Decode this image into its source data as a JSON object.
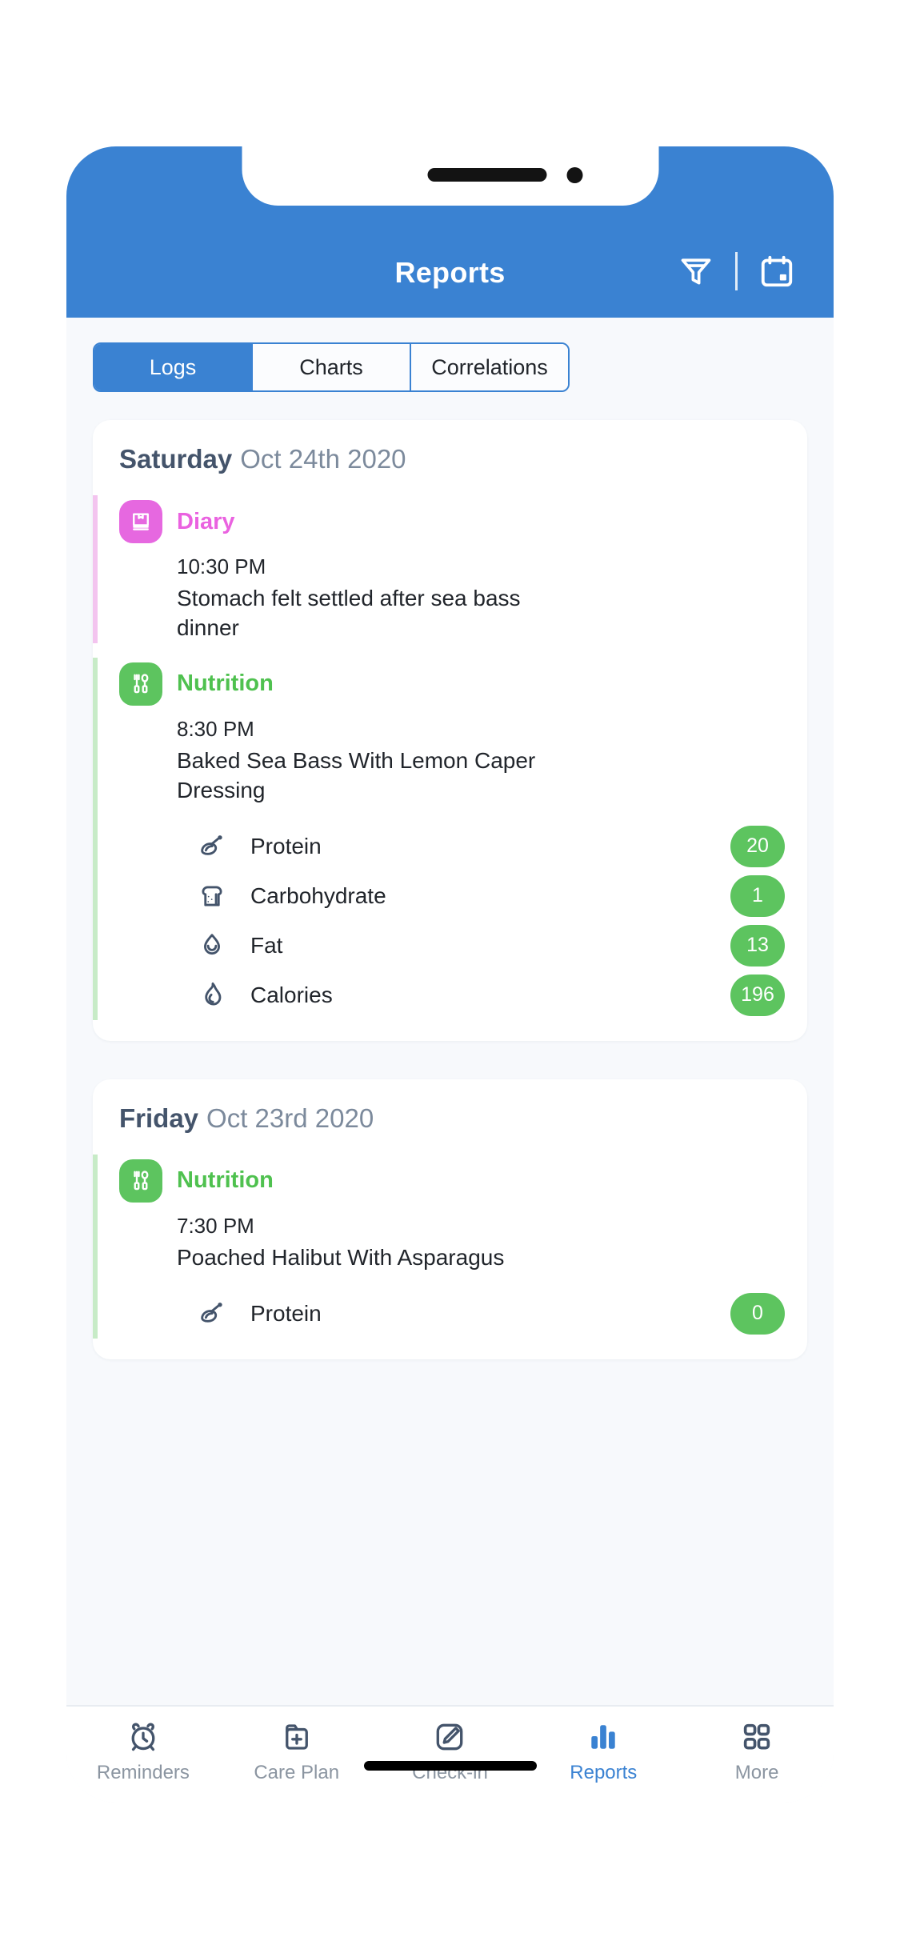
{
  "header": {
    "title": "Reports",
    "brand_color": "#3a82d2",
    "filter_icon": "filter-icon",
    "calendar_icon": "calendar-icon"
  },
  "tabs": [
    {
      "label": "Logs",
      "active": true
    },
    {
      "label": "Charts",
      "active": false
    },
    {
      "label": "Correlations",
      "active": false
    }
  ],
  "cards": [
    {
      "day": "Saturday",
      "date": "Oct 24th 2020",
      "entries": [
        {
          "category": "Diary",
          "category_color": "#ea62e0",
          "rail_color": "#f3c4ef",
          "badge_color": "#e668e0",
          "icon": "journal-icon",
          "time": "10:30 PM",
          "text": "Stomach felt settled after sea bass dinner",
          "nutrients": []
        },
        {
          "category": "Nutrition",
          "category_color": "#4fc14f",
          "rail_color": "#c7ebc7",
          "badge_color": "#5dc45f",
          "icon": "cutlery-icon",
          "time": "8:30 PM",
          "text": "Baked Sea Bass With Lemon Caper Dressing",
          "nutrients": [
            {
              "label": "Protein",
              "icon": "meat-icon",
              "value": "20",
              "color": "#5dc45f"
            },
            {
              "label": "Carbohydrate",
              "icon": "bread-icon",
              "value": "1",
              "color": "#5dc45f"
            },
            {
              "label": "Fat",
              "icon": "drop-icon",
              "value": "13",
              "color": "#5dc45f"
            },
            {
              "label": "Calories",
              "icon": "flame-icon",
              "value": "196",
              "color": "#5dc45f"
            }
          ]
        }
      ]
    },
    {
      "day": "Friday",
      "date": "Oct 23rd 2020",
      "entries": [
        {
          "category": "Nutrition",
          "category_color": "#4fc14f",
          "rail_color": "#c7ebc7",
          "badge_color": "#5dc45f",
          "icon": "cutlery-icon",
          "time": "7:30 PM",
          "text": "Poached Halibut With Asparagus",
          "nutrients": [
            {
              "label": "Protein",
              "icon": "meat-icon",
              "value": "0",
              "color": "#5dc45f"
            }
          ]
        }
      ]
    }
  ],
  "bottom_nav": [
    {
      "label": "Reminders",
      "icon": "alarm-clock-icon",
      "active": false
    },
    {
      "label": "Care Plan",
      "icon": "folder-plus-icon",
      "active": false
    },
    {
      "label": "Check-in",
      "icon": "pencil-square-icon",
      "active": false
    },
    {
      "label": "Reports",
      "icon": "bar-chart-icon",
      "active": true
    },
    {
      "label": "More",
      "icon": "grid-icon",
      "active": false
    }
  ]
}
